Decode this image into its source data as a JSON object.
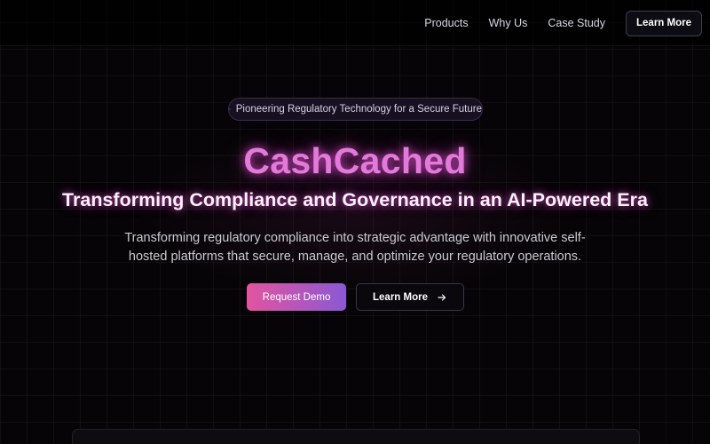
{
  "nav": {
    "links": [
      "Products",
      "Why Us",
      "Case Study"
    ],
    "cta_label": "Learn More"
  },
  "hero": {
    "badge_icon": "shield-icon",
    "badge_text": "Pioneering Regulatory Technology for a Secure Future",
    "brand": "CashCached",
    "headline": "Transforming Compliance and Governance in an AI-Powered Era",
    "subheadline": "Transforming regulatory compliance into strategic advantage with innovative self-hosted platforms that secure, manage, and optimize your regulatory operations.",
    "primary_cta": "Request Demo",
    "secondary_cta": "Learn More",
    "secondary_cta_icon": "arrow-right-icon"
  },
  "colors": {
    "brand_glow": "#e17ad8",
    "primary_gradient_start": "#e3549f",
    "primary_gradient_end": "#8b58d4",
    "background": "#060406"
  }
}
